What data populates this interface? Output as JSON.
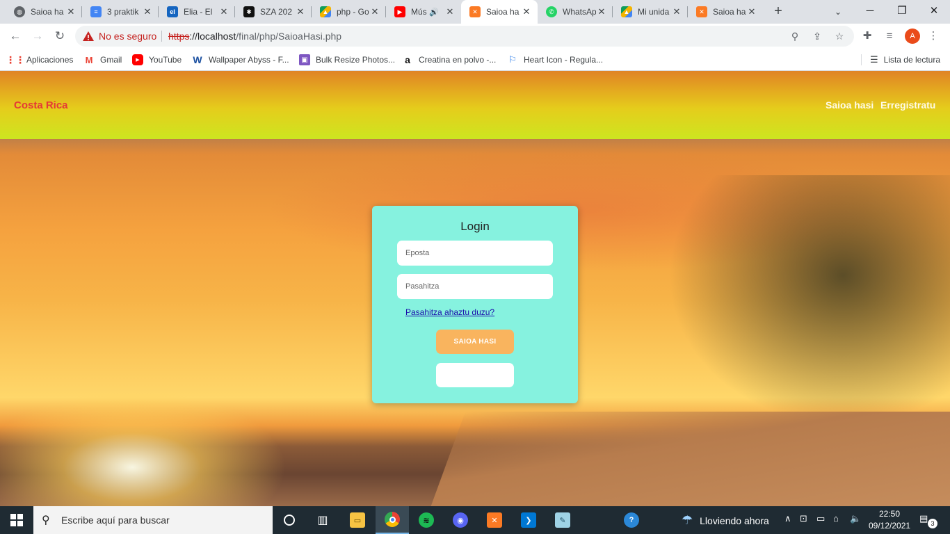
{
  "browser": {
    "tabs": [
      {
        "title": "Saioa ha",
        "icon": "globe-icon"
      },
      {
        "title": "3 praktik",
        "icon": "google-docs-icon"
      },
      {
        "title": "Elia - El",
        "icon": "elia-icon"
      },
      {
        "title": "SZA 202",
        "icon": "music-site-icon"
      },
      {
        "title": "php - Go",
        "icon": "google-drive-icon"
      },
      {
        "title": "Mús",
        "icon": "youtube-icon"
      },
      {
        "title": "Saioa ha",
        "icon": "xampp-icon"
      },
      {
        "title": "WhatsAp",
        "icon": "whatsapp-icon"
      },
      {
        "title": "Mi unida",
        "icon": "google-drive-icon"
      },
      {
        "title": "Saioa ha",
        "icon": "xampp-icon"
      }
    ],
    "active_tab": 6,
    "address": {
      "security_label": "No es seguro",
      "scheme": "https",
      "host": "://localhost",
      "path": "/final/php/SaioaHasi.php"
    },
    "profile_initial": "A",
    "bookmarks": [
      {
        "label": "Aplicaciones",
        "icon": "apps-grid-icon"
      },
      {
        "label": "Gmail",
        "icon": "gmail-icon"
      },
      {
        "label": "YouTube",
        "icon": "youtube-icon"
      },
      {
        "label": "Wallpaper Abyss - F...",
        "icon": "wallpaper-abyss-icon"
      },
      {
        "label": "Bulk Resize Photos...",
        "icon": "bulk-resize-icon"
      },
      {
        "label": "Creatina en polvo -...",
        "icon": "amazon-icon"
      },
      {
        "label": "Heart Icon - Regula...",
        "icon": "flag-icon"
      }
    ],
    "reading_list": "Lista de lectura"
  },
  "site": {
    "brand": "Costa Rica",
    "nav": [
      "Saioa hasi",
      "Erregistratu"
    ],
    "colors": {
      "brand": "#e53935",
      "card": "#86f2df",
      "button": "#f9b45e"
    }
  },
  "login": {
    "title": "Login",
    "email_placeholder": "Eposta",
    "password_placeholder": "Pasahitza",
    "forgot_link": "Pasahitza ahaztu duzu?",
    "submit_label": "SAIOA HASI",
    "secondary_label": ""
  },
  "taskbar": {
    "search_placeholder": "Escribe aquí para buscar",
    "weather": "Lloviendo ahora",
    "time": "22:50",
    "date": "09/12/2021",
    "notifications": "3"
  }
}
